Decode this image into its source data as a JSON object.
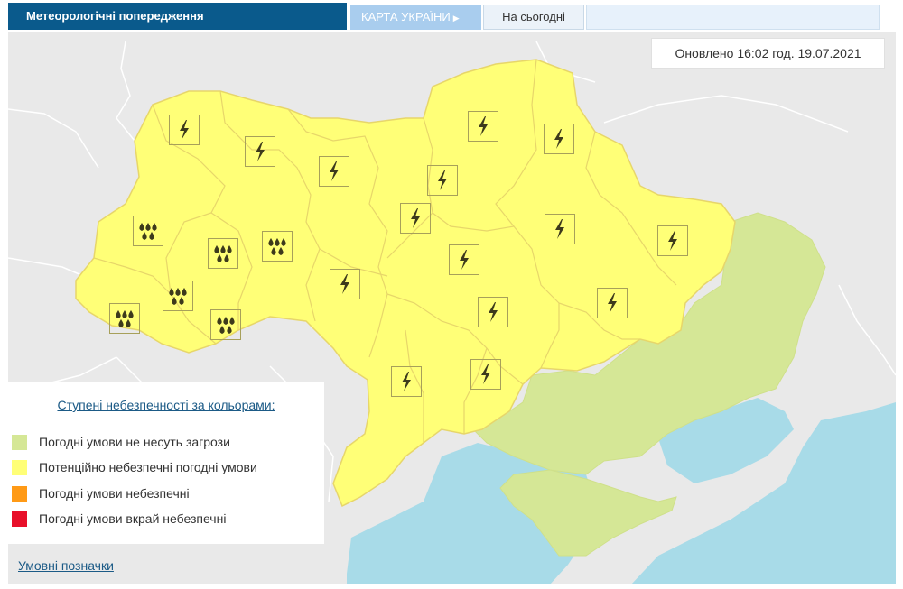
{
  "tabs": {
    "main": "Метеорологічні попередження",
    "map": "КАРТА УКРАЇНИ",
    "today": "На сьогодні"
  },
  "updated": "Оновлено 16:02 год. 19.07.2021",
  "colors": {
    "neighbor": "#e9e9e9",
    "sea": "#a8dbe8",
    "yellow": "#ffff77",
    "green": "#d5e796",
    "border": "#e7d66a",
    "orange": "#ff9a16",
    "red": "#e8102a",
    "icon_color": "#3d3a1c"
  },
  "legend": {
    "title": "Ступені небезпечності за кольорами:",
    "items": [
      {
        "label": "Погодні умови не несуть загрози",
        "color": "#d5e796"
      },
      {
        "label": "Потенційно небезпечні погодні умови",
        "color": "#ffff77"
      },
      {
        "label": "Погодні умови небезпечні",
        "color": "#ff9a16"
      },
      {
        "label": "Погодні умови вкрай небезпечні",
        "color": "#e8102a"
      }
    ]
  },
  "footer_link": "Умовні позначки",
  "warnings": [
    {
      "type": "thunderstorm-icon"
    },
    {
      "type": "thunderstorm-icon"
    },
    {
      "type": "thunderstorm-icon"
    },
    {
      "type": "thunderstorm-icon"
    },
    {
      "type": "thunderstorm-icon"
    },
    {
      "type": "thunderstorm-icon"
    },
    {
      "type": "thunderstorm-icon"
    },
    {
      "type": "thunderstorm-icon"
    },
    {
      "type": "thunderstorm-icon"
    },
    {
      "type": "thunderstorm-icon"
    },
    {
      "type": "thunderstorm-icon"
    },
    {
      "type": "thunderstorm-icon"
    },
    {
      "type": "thunderstorm-icon"
    },
    {
      "type": "thunderstorm-icon"
    },
    {
      "type": "thunderstorm-icon"
    },
    {
      "type": "rain-icon"
    },
    {
      "type": "rain-icon"
    },
    {
      "type": "rain-icon"
    },
    {
      "type": "rain-icon"
    },
    {
      "type": "rain-icon"
    },
    {
      "type": "rain-icon"
    }
  ]
}
